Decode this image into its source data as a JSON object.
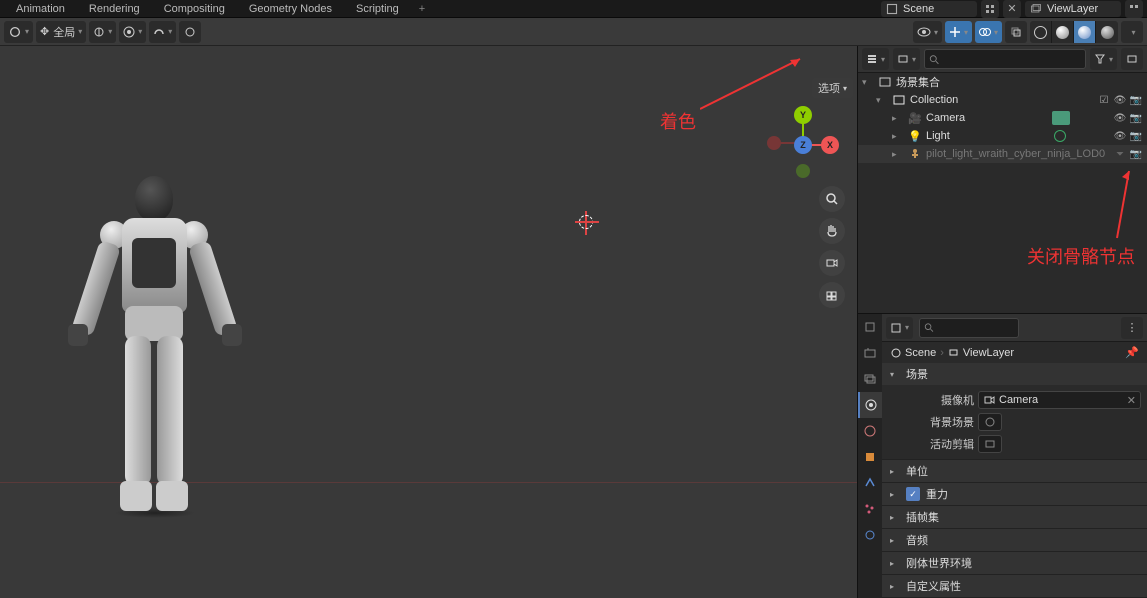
{
  "top_tabs": [
    "Animation",
    "Rendering",
    "Compositing",
    "Geometry Nodes",
    "Scripting"
  ],
  "scene": {
    "label": "Scene",
    "name": "Scene"
  },
  "viewlayer": {
    "label": "ViewLayer",
    "name": "ViewLayer"
  },
  "header": {
    "mode_label": "全局",
    "options_label": "选项"
  },
  "annotations": {
    "shading": "着色",
    "close_bone": "关闭骨骼节点"
  },
  "outliner": {
    "root": "场景集合",
    "collection": "Collection",
    "items": [
      {
        "name": "Camera",
        "icon": "camera",
        "special": "green-box"
      },
      {
        "name": "Light",
        "icon": "light",
        "special": "green-dot"
      },
      {
        "name": "pilot_light_wraith_cyber_ninja_LOD0",
        "icon": "armature",
        "dim": true
      }
    ]
  },
  "properties": {
    "breadcrumb_scene": "Scene",
    "breadcrumb_layer": "ViewLayer",
    "sections": {
      "scene_panel": "场景",
      "camera_label": "摄像机",
      "camera_value": "Camera",
      "bg_scene_label": "背景场景",
      "active_clip_label": "活动剪辑",
      "units": "单位",
      "gravity": "重力",
      "keying": "插帧集",
      "audio": "音频",
      "rigid_world": "刚体世界环境",
      "custom_props": "自定义属性"
    }
  }
}
